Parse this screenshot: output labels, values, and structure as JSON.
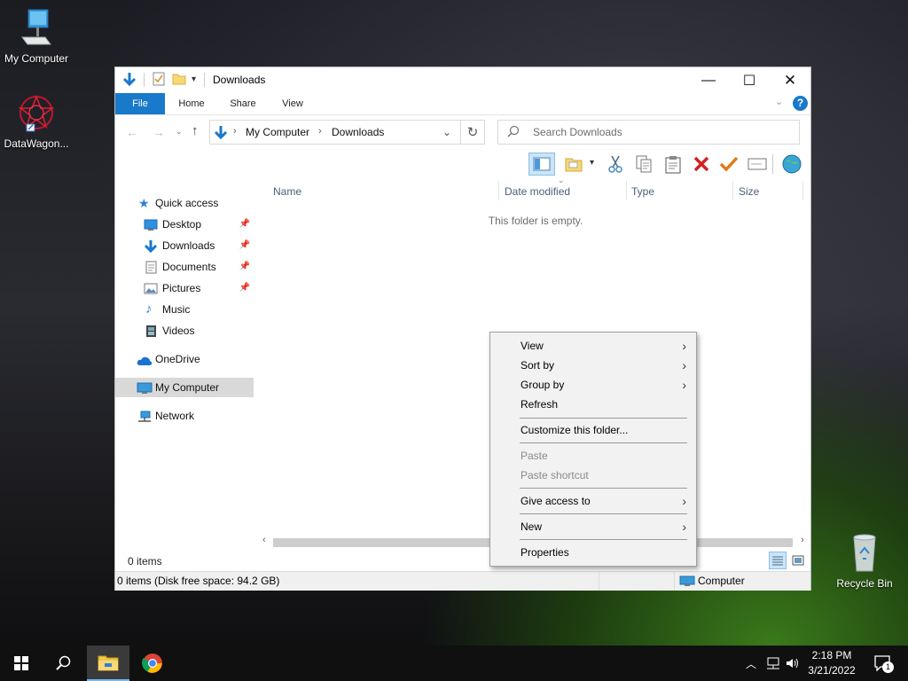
{
  "desktop": {
    "icons": [
      {
        "label": "My Computer",
        "icon": "computer-icon"
      },
      {
        "label": "DataWagon...",
        "icon": "datawagon-shortcut-icon"
      },
      {
        "label": "Recycle Bin",
        "icon": "recycle-bin-icon"
      }
    ]
  },
  "window": {
    "title": "Downloads",
    "ribbon_tabs": [
      "File",
      "Home",
      "Share",
      "View"
    ],
    "address": {
      "segments": [
        "My Computer",
        "Downloads"
      ]
    },
    "search": {
      "placeholder": "Search Downloads"
    },
    "toolbar_icons": [
      "preview-pane-icon",
      "new-folder-icon",
      "cut-icon",
      "copy-icon",
      "paste-icon",
      "delete-icon",
      "check-icon",
      "rename-icon",
      "globe-icon"
    ],
    "nav_pane": {
      "items": [
        {
          "label": "Quick access",
          "icon": "star-icon",
          "pinned": false,
          "selected": false
        },
        {
          "label": "Desktop",
          "icon": "desktop-icon",
          "pinned": true,
          "selected": false
        },
        {
          "label": "Downloads",
          "icon": "download-arrow-icon",
          "pinned": true,
          "selected": false
        },
        {
          "label": "Documents",
          "icon": "document-icon",
          "pinned": true,
          "selected": false
        },
        {
          "label": "Pictures",
          "icon": "picture-icon",
          "pinned": true,
          "selected": false
        },
        {
          "label": "Music",
          "icon": "music-note-icon",
          "pinned": false,
          "selected": false
        },
        {
          "label": "Videos",
          "icon": "film-icon",
          "pinned": false,
          "selected": false
        },
        {
          "label": "OneDrive",
          "icon": "cloud-icon",
          "pinned": false,
          "selected": false
        },
        {
          "label": "My Computer",
          "icon": "computer-icon",
          "pinned": false,
          "selected": true
        },
        {
          "label": "Network",
          "icon": "network-icon",
          "pinned": false,
          "selected": false
        }
      ]
    },
    "columns": [
      "Name",
      "Date modified",
      "Type",
      "Size"
    ],
    "empty_message": "This folder is empty.",
    "status": {
      "item_count": "0 items",
      "disk_info": "0 items (Disk free space: 94.2 GB)",
      "location": "Computer"
    }
  },
  "context_menu": {
    "items": [
      {
        "label": "View",
        "submenu": true,
        "disabled": false
      },
      {
        "label": "Sort by",
        "submenu": true,
        "disabled": false
      },
      {
        "label": "Group by",
        "submenu": true,
        "disabled": false
      },
      {
        "label": "Refresh",
        "submenu": false,
        "disabled": false
      },
      {
        "label": "Customize this folder...",
        "submenu": false,
        "disabled": false
      },
      {
        "label": "Paste",
        "submenu": false,
        "disabled": true
      },
      {
        "label": "Paste shortcut",
        "submenu": false,
        "disabled": true
      },
      {
        "label": "Give access to",
        "submenu": true,
        "disabled": false
      },
      {
        "label": "New",
        "submenu": true,
        "disabled": false
      },
      {
        "label": "Properties",
        "submenu": false,
        "disabled": false
      }
    ]
  },
  "taskbar": {
    "items": [
      "start-icon",
      "search-icon",
      "file-explorer-icon",
      "chrome-icon"
    ],
    "clock": {
      "time": "2:18 PM",
      "date": "3/21/2022"
    },
    "notification_count": "1"
  }
}
